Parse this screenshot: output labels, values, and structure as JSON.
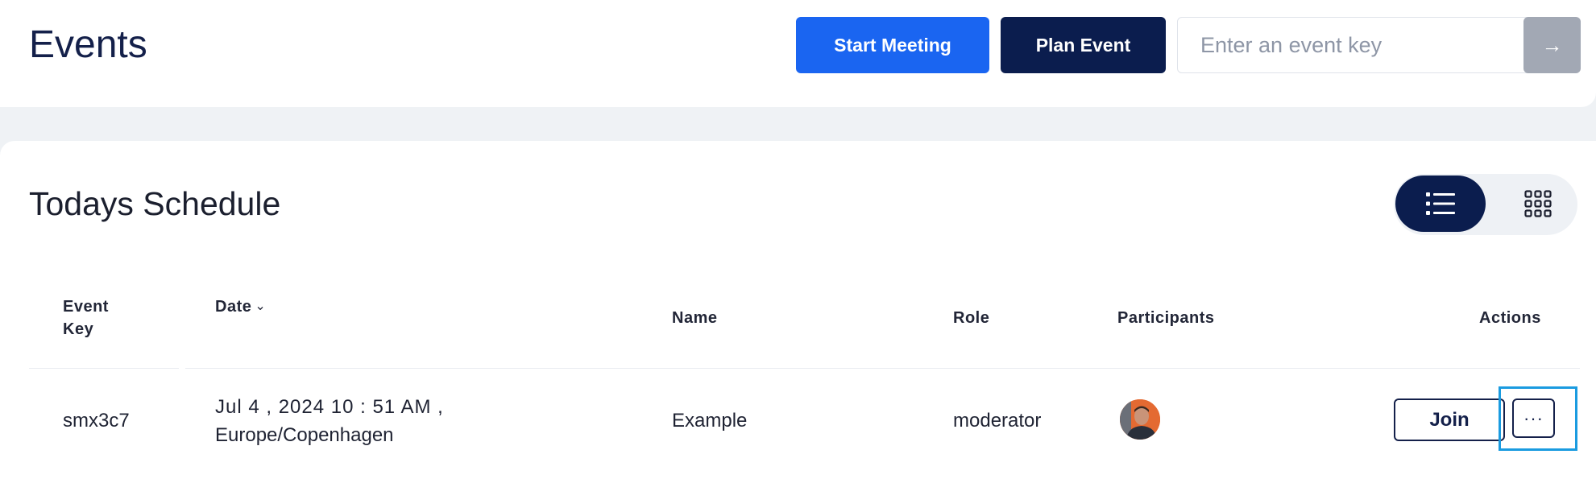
{
  "header": {
    "title": "Events",
    "start_meeting_label": "Start Meeting",
    "plan_event_label": "Plan Event",
    "event_key_placeholder": "Enter an event key",
    "go_icon": "→",
    "colors": {
      "start_meeting": "#1a65f1",
      "plan_event": "#0b1d4e",
      "go_button": "#a2a8b4"
    }
  },
  "schedule": {
    "title": "Todays Schedule",
    "view_toggle": {
      "active": "list",
      "options": [
        "list-icon",
        "grid-icon"
      ]
    },
    "columns": {
      "event_key": "Event Key",
      "date": "Date",
      "date_sort_icon": "⌄",
      "name": "Name",
      "role": "Role",
      "participants": "Participants",
      "actions": "Actions"
    },
    "rows": [
      {
        "event_key": "smx3c7",
        "date_line1": "Jul 4 , 2024 10 : 51 AM ,",
        "date_line2": "Europe/Copenhagen",
        "name": "Example",
        "role": "moderator",
        "participants": [
          "participant-avatar"
        ],
        "join_label": "Join",
        "more_label": "···"
      }
    ]
  }
}
